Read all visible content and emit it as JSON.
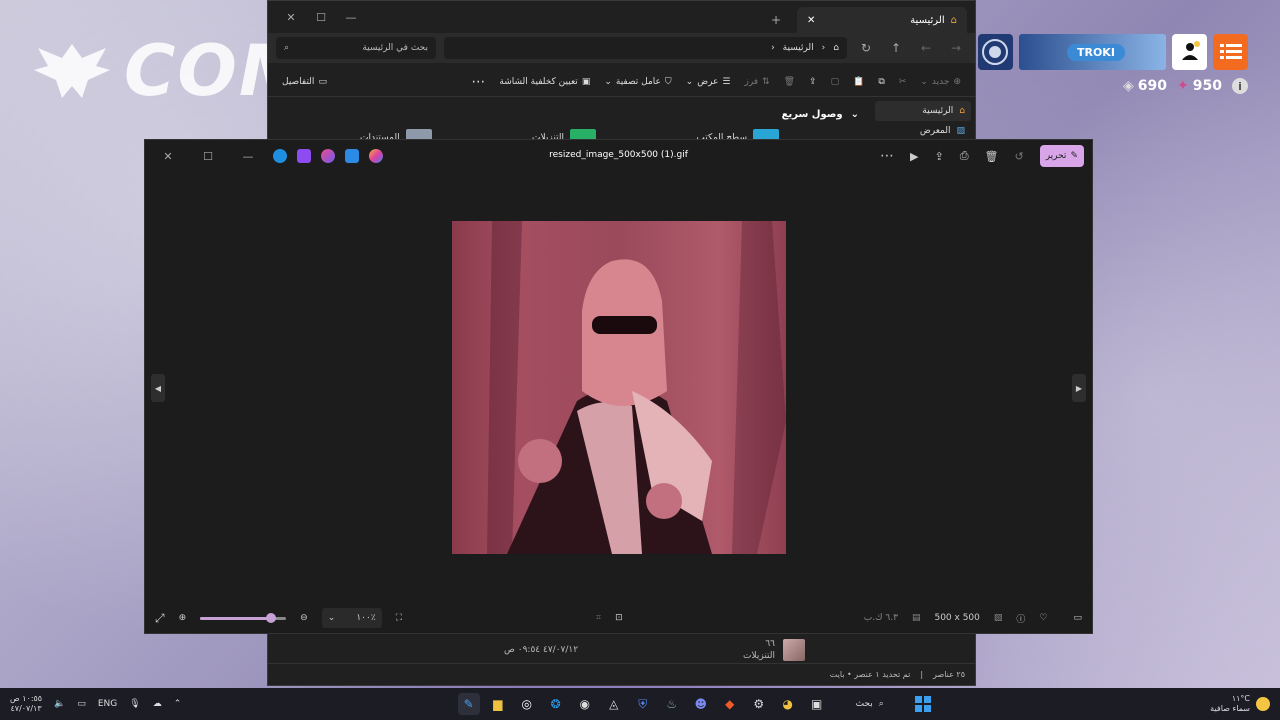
{
  "game": {
    "logo_text": "COMP",
    "player_name": "TROKI",
    "currency_a": "690",
    "currency_b": "950"
  },
  "explorer": {
    "tab_title": "الرئيسية",
    "search_placeholder": "بحث في الرئيسية",
    "path": "الرئيسية",
    "toolbar": {
      "new": "جديد",
      "sort": "فرز",
      "view": "عرض",
      "filter": "عامل تصفية",
      "set_wallpaper": "تعيين كخلفية الشاشة",
      "details": "التفاصيل"
    },
    "sidebar": [
      "الرئيسية",
      "المعرض"
    ],
    "quick_access": {
      "label": "وصول سريع",
      "items": [
        "سطح المكتب",
        "التنزيلات",
        "المستندات"
      ]
    },
    "file_row": {
      "name": "٦٦",
      "location": "التنزيلات",
      "date": "٤٧/٠٧/١٢ ٠٩:٥٤ ص"
    },
    "status": {
      "count": "٢٥ عناصر",
      "selected": "تم تحديد ١ عنصر • بايت"
    }
  },
  "viewer": {
    "filename": "resized_image_500x500 (1).gif",
    "edit_label": "تحرير",
    "zoom": "١٠٠٪",
    "dimensions": "500 x 500",
    "filesize": "٦.٣ ك.ب",
    "zoom_fraction": 0.82
  },
  "taskbar": {
    "search_label": "بحث",
    "language": "ENG",
    "time": "١٠:٥٥ ص",
    "date": "٤٧/٠٧/١٣",
    "temperature": "١١°C",
    "weather": "سماء صافية"
  }
}
